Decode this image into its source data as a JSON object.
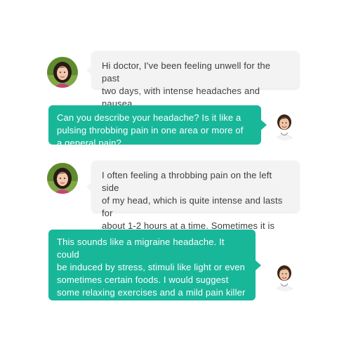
{
  "conversation": {
    "messages": [
      {
        "sender": "patient",
        "avatar_icon": "patient-avatar-icon",
        "text": "Hi doctor, I've been feeling unwell for the past\ntwo days, with intense headaches and nausea."
      },
      {
        "sender": "doctor",
        "avatar_icon": "doctor-avatar-icon",
        "text": "Can you describe your headache? Is it like a\npulsing throbbing pain in one area or more of\na general pain?"
      },
      {
        "sender": "patient",
        "avatar_icon": "patient-avatar-icon",
        "text": "I often feeling a throbbing pain on the left side\nof my head, which is quite intense and lasts for\nabout 1-2 hours at a time. Sometimes it is\naccompanied by a feeling of nausea."
      },
      {
        "sender": "doctor",
        "avatar_icon": "doctor-avatar-icon",
        "text": "This sounds like a migraine headache. It could\nbe induced by stress, stimuli like light or even\nsometimes certain foods. I would suggest\nsome relaxing exercises and a mild pain killer\nfor temporary relief. However, please check in\nwith me if the problem persists."
      }
    ]
  },
  "colors": {
    "doctor_bubble": "#19b79a",
    "patient_bubble": "#f3f3f3",
    "patient_text": "#3d3d3d",
    "doctor_text": "#ffffff"
  }
}
